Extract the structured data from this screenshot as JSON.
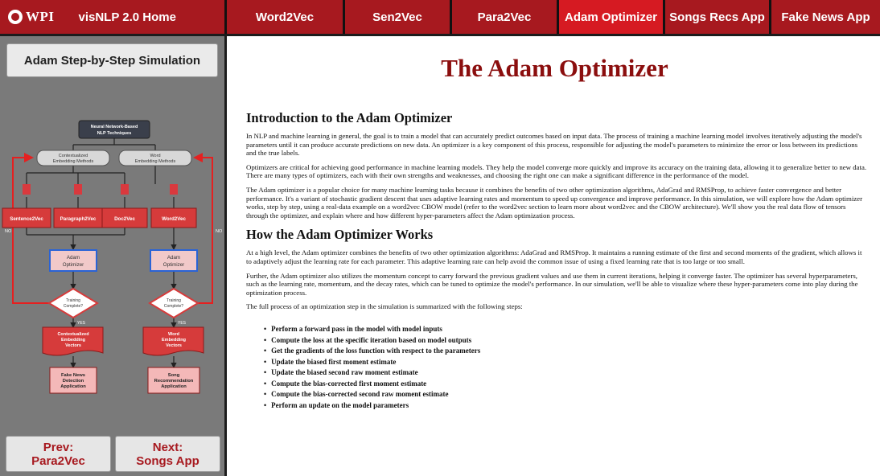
{
  "nav": {
    "logo_text": "WPI",
    "home": "visNLP 2.0 Home",
    "tabs": [
      {
        "label": "Word2Vec"
      },
      {
        "label": "Sen2Vec"
      },
      {
        "label": "Para2Vec"
      },
      {
        "label": "Adam Optimizer"
      },
      {
        "label": "Songs Recs App"
      },
      {
        "label": "Fake News App"
      }
    ],
    "active_tab": "Adam Optimizer"
  },
  "sidebar": {
    "sim_button": "Adam Step-by-Step Simulation",
    "flowchart": {
      "root": [
        "Neural Network-Based",
        "NLP Techniques"
      ],
      "branch_left": [
        "Contextualized",
        "Embedding Methods"
      ],
      "branch_right": [
        "Word",
        "Embedding Methods"
      ],
      "methods": [
        "Sentence2Vec",
        "Paragraph2Vec",
        "Doc2Vec",
        "Word2Vec"
      ],
      "optimizer": [
        "Adam",
        "Optimizer"
      ],
      "decision": [
        "Training",
        "Complete?"
      ],
      "no_label": "NO",
      "yes_label": "YES",
      "vectors_left": [
        "Contextualized",
        "Embedding",
        "Vectors"
      ],
      "vectors_right": [
        "Word",
        "Embedding",
        "Vectors"
      ],
      "app_left": [
        "Fake News",
        "Detection",
        "Application"
      ],
      "app_right": [
        "Song",
        "Recommendation",
        "Application"
      ]
    },
    "prev": {
      "line1": "Prev:",
      "line2": "Para2Vec"
    },
    "next": {
      "line1": "Next:",
      "line2": "Songs App"
    }
  },
  "main": {
    "title": "The Adam Optimizer",
    "section1_heading": "Introduction to the Adam Optimizer",
    "section1_paragraphs": [
      "In NLP and machine learning in general, the goal is to train a model that can accurately predict outcomes based on input data. The process of training a machine learning model involves iteratively adjusting the model's parameters until it can produce accurate predictions on new data. An optimizer is a key component of this process, responsible for adjusting the model's parameters to minimize the error or loss between its predictions and the true labels.",
      "Optimizers are critical for achieving good performance in machine learning models. They help the model converge more quickly and improve its accuracy on the training data, allowing it to generalize better to new data. There are many types of optimizers, each with their own strengths and weaknesses, and choosing the right one can make a significant difference in the performance of the model.",
      "The Adam optimizer is a popular choice for many machine learning tasks because it combines the benefits of two other optimization algorithms, AdaGrad and RMSProp, to achieve faster convergence and better performance. It's a variant of stochastic gradient descent that uses adaptive learning rates and momentum to speed up convergence and improve performance. In this simulation, we will explore how the Adam optimizer works, step by step, using a real-data example on a word2vec CBOW model (refer to the word2vec section to learn more about word2vec and the CBOW architecture). We'll show you the real data flow of tensors through the optimizer, and explain where and how different hyper-parameters affect the Adam optimization process."
    ],
    "section2_heading": "How the Adam Optimizer Works",
    "section2_paragraphs": [
      "At a high level, the Adam optimizer combines the benefits of two other optimization algorithms: AdaGrad and RMSProp. It maintains a running estimate of the first and second moments of the gradient, which allows it to adaptively adjust the learning rate for each parameter. This adaptive learning rate can help avoid the common issue of using a fixed learning rate that is too large or too small.",
      "Further, the Adam optimizer also utilizes the momentum concept to carry forward the previous gradient values and use them in current iterations, helping it converge faster. The optimizer has several hyperparameters, such as the learning rate, momentum, and the decay rates, which can be tuned to optimize the model's performance. In our simulation, we'll be able to visualize where these hyper-parameters come into play during the optimization process.",
      "The full process of an optimization step in the simulation is summarized with the following steps:"
    ],
    "steps": [
      "Perform a forward pass in the model with model inputs",
      "Compute the loss at the specific iteration based on model outputs",
      "Get the gradients of the loss function with respect to the parameters",
      "Update the biased first moment estimate",
      "Update the biased second raw moment estimate",
      "Compute the bias-corrected first moment estimate",
      "Compute the bias-corrected second raw moment estimate",
      "Perform an update on the model parameters"
    ]
  },
  "colors": {
    "brand_red": "#a7191f",
    "active_tab": "#d61a22",
    "title_red": "#8b0e0e",
    "sidebar_gray": "#7a7a7a"
  }
}
